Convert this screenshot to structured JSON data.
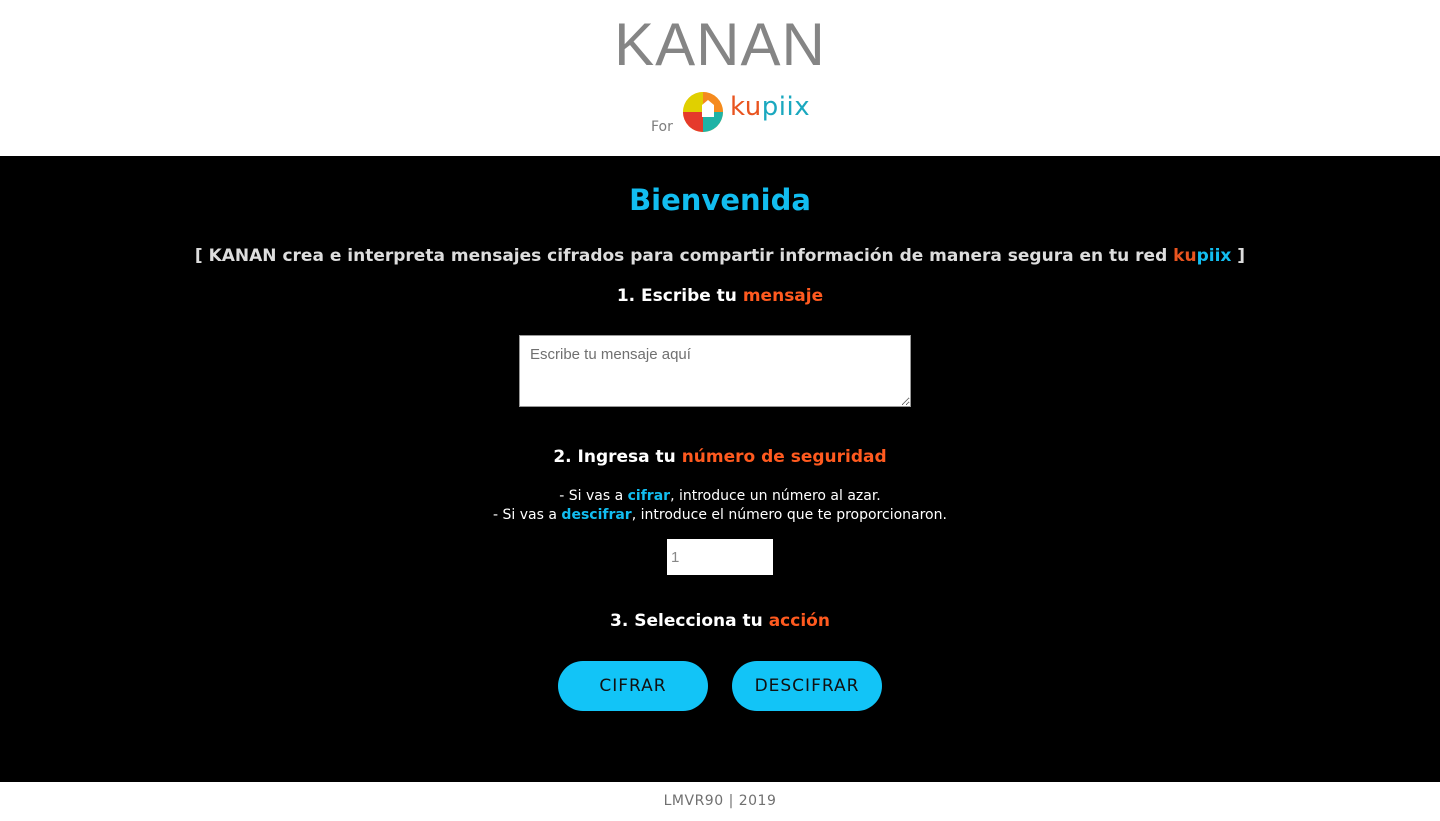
{
  "header": {
    "title": "KANAN",
    "for_label": "For",
    "logo": {
      "part1": "ku",
      "part2": "piix"
    }
  },
  "main": {
    "welcome": "Bienvenida",
    "intro": {
      "before": "[ KANAN crea e interpreta mensajes cifrados para compartir información de manera segura en tu red ",
      "brand_part1": "ku",
      "brand_part2": "piix",
      "after": " ]"
    },
    "step1": {
      "prefix": "1. Escribe tu ",
      "highlight": "mensaje"
    },
    "message_input": {
      "placeholder": "Escribe tu mensaje aquí",
      "value": ""
    },
    "step2": {
      "prefix": "2. Ingresa tu ",
      "highlight": "número de seguridad"
    },
    "hints": {
      "line1_prefix": "- Si vas a ",
      "line1_highlight": "cifrar",
      "line1_suffix": ", introduce un número al azar.",
      "line2_prefix": "- Si vas a ",
      "line2_highlight": "descifrar",
      "line2_suffix": ", introduce el número que te proporcionaron."
    },
    "security_number": {
      "value": "1"
    },
    "step3": {
      "prefix": "3. Selecciona tu ",
      "highlight": "acción"
    },
    "buttons": {
      "encrypt": "CIFRAR",
      "decrypt": "DESCIFRAR"
    }
  },
  "footer": {
    "text": "LMVR90 | 2019"
  },
  "colors": {
    "accent_blue": "#12bdf0",
    "accent_orange": "#ff5a1f",
    "button_blue": "#12c4f7",
    "background": "#000000"
  }
}
